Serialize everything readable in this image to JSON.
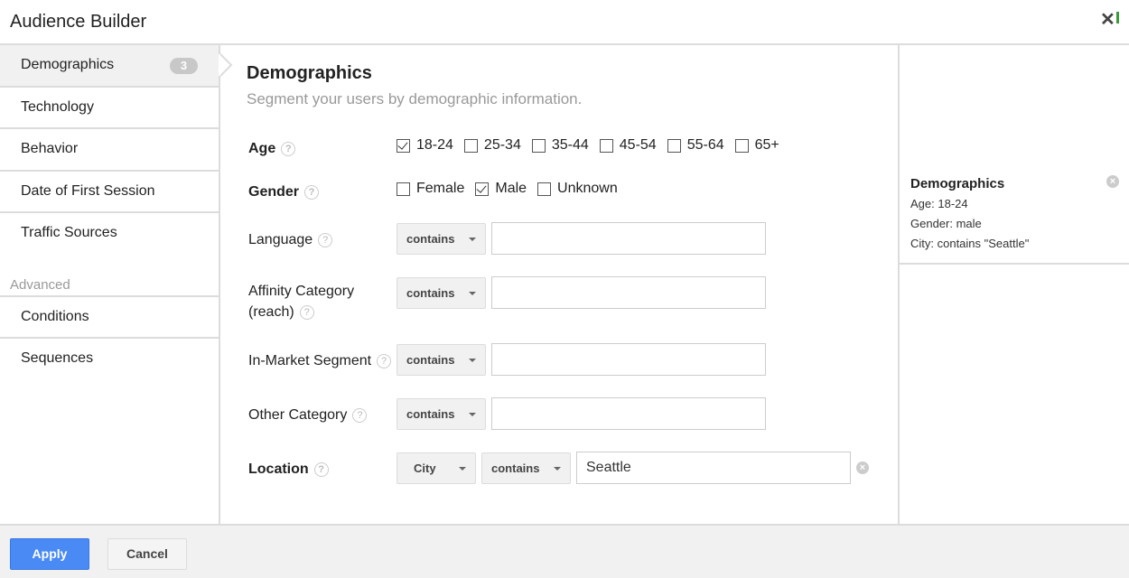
{
  "header": {
    "title": "Audience Builder",
    "close_label": "✕"
  },
  "sidebar": {
    "items": [
      {
        "label": "Demographics",
        "badge": "3",
        "active": true
      },
      {
        "label": "Technology"
      },
      {
        "label": "Behavior"
      },
      {
        "label": "Date of First Session"
      },
      {
        "label": "Traffic Sources"
      }
    ],
    "advanced_label": "Advanced",
    "advanced_items": [
      {
        "label": "Conditions"
      },
      {
        "label": "Sequences"
      }
    ]
  },
  "main": {
    "title": "Demographics",
    "subtitle": "Segment your users by demographic information.",
    "help_glyph": "?",
    "age": {
      "label": "Age",
      "options": [
        {
          "label": "18-24",
          "checked": true
        },
        {
          "label": "25-34",
          "checked": false
        },
        {
          "label": "35-44",
          "checked": false
        },
        {
          "label": "45-54",
          "checked": false
        },
        {
          "label": "55-64",
          "checked": false
        },
        {
          "label": "65+",
          "checked": false
        }
      ]
    },
    "gender": {
      "label": "Gender",
      "options": [
        {
          "label": "Female",
          "checked": false
        },
        {
          "label": "Male",
          "checked": true
        },
        {
          "label": "Unknown",
          "checked": false
        }
      ]
    },
    "language": {
      "label": "Language",
      "operator": "contains",
      "value": ""
    },
    "affinity": {
      "label_line1": "Affinity Category",
      "label_line2": "(reach)",
      "operator": "contains",
      "value": ""
    },
    "in_market": {
      "label": "In-Market Segment",
      "operator": "contains",
      "value": ""
    },
    "other": {
      "label": "Other Category",
      "operator": "contains",
      "value": ""
    },
    "location": {
      "label": "Location",
      "dimension": "City",
      "operator": "contains",
      "value": "Seattle"
    }
  },
  "summary": {
    "title": "Demographics",
    "lines": [
      "Age: 18-24",
      "Gender: male",
      "City: contains \"Seattle\""
    ]
  },
  "footer": {
    "apply_label": "Apply",
    "cancel_label": "Cancel"
  }
}
